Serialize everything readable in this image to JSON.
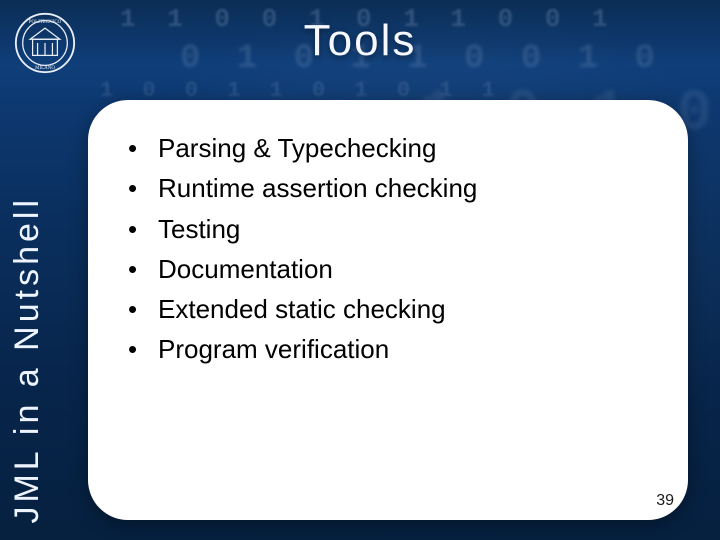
{
  "slide": {
    "title": "Tools",
    "section_label": "JML in a Nutshell",
    "page_number": "39",
    "bullets": [
      "Parsing & Typechecking",
      "Runtime assertion checking",
      "Testing",
      "Documentation",
      "Extended static checking",
      "Program verification"
    ],
    "bg_digits": [
      "1 1 0 0 1 0 1 1 0 0 1",
      "0 1 0 1 1 0 0 1 0",
      "1 0 0 1 1 0 1 0 1 1",
      "1 0 1 0 1",
      "0 1 0"
    ],
    "logo": {
      "name": "politecnico-milano-seal"
    }
  }
}
